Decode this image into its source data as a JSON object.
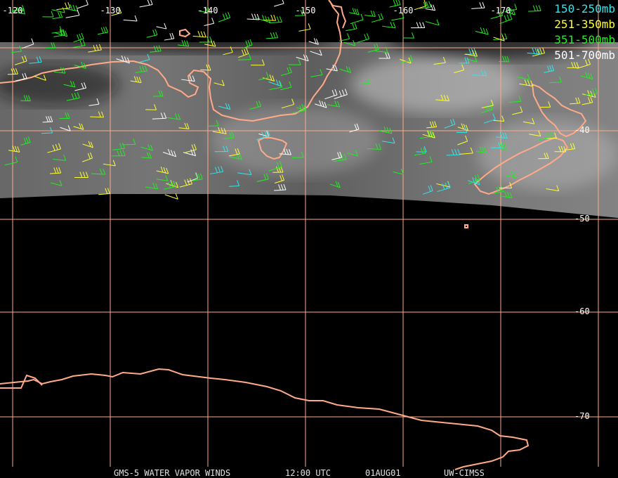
{
  "legend": {
    "items": [
      {
        "label": "150-250mb",
        "color": "#33e6ee"
      },
      {
        "label": "251-350mb",
        "color": "#ffff33"
      },
      {
        "label": "351-500mb",
        "color": "#22ee22"
      },
      {
        "label": "501-700mb",
        "color": "#ffffff"
      }
    ]
  },
  "grid": {
    "color": "#ffaa88",
    "longitudes": [
      "-120",
      "-130",
      "-140",
      "-150",
      "-160",
      "-170"
    ],
    "latitudes": [
      "-40",
      "-50",
      "-60",
      "-70"
    ]
  },
  "coastline_color": "#ffaa88",
  "footer": {
    "product": "GMS-5 WATER VAPOR WINDS",
    "time": "12:00 UTC",
    "date": "01AUG01",
    "source": "UW-CIMSS"
  }
}
